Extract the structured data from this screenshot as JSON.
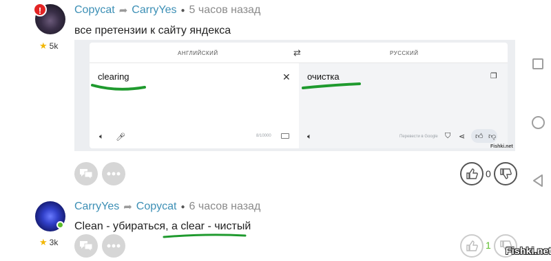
{
  "comments": [
    {
      "alert_badge": "!",
      "author": "Copycat",
      "reply_to": "CarryYes",
      "time": "5 часов назад",
      "karma": "5k",
      "text": "все претензии к сайту яндекса",
      "image": {
        "lang_from": "АНГЛИЙСКИЙ",
        "lang_to": "РУССКИЙ",
        "source_text": "clearing",
        "translated_text": "очистка",
        "char_count": "8/10000",
        "google_link": "Перевести в Google",
        "watermark": "Fishki.net"
      },
      "vote_count": "0"
    },
    {
      "author": "CarryYes",
      "reply_to": "Copycat",
      "time": "6 часов назад",
      "karma": "3k",
      "text": "Clean - убираться, а clear - чистый",
      "vote_count": "1"
    }
  ],
  "site_watermark": "Fishki.net",
  "colors": {
    "author": "#3c8fb5",
    "underline": "#1f9a2e",
    "vote_positive": "#5bbd2a",
    "alert": "#e32424"
  }
}
